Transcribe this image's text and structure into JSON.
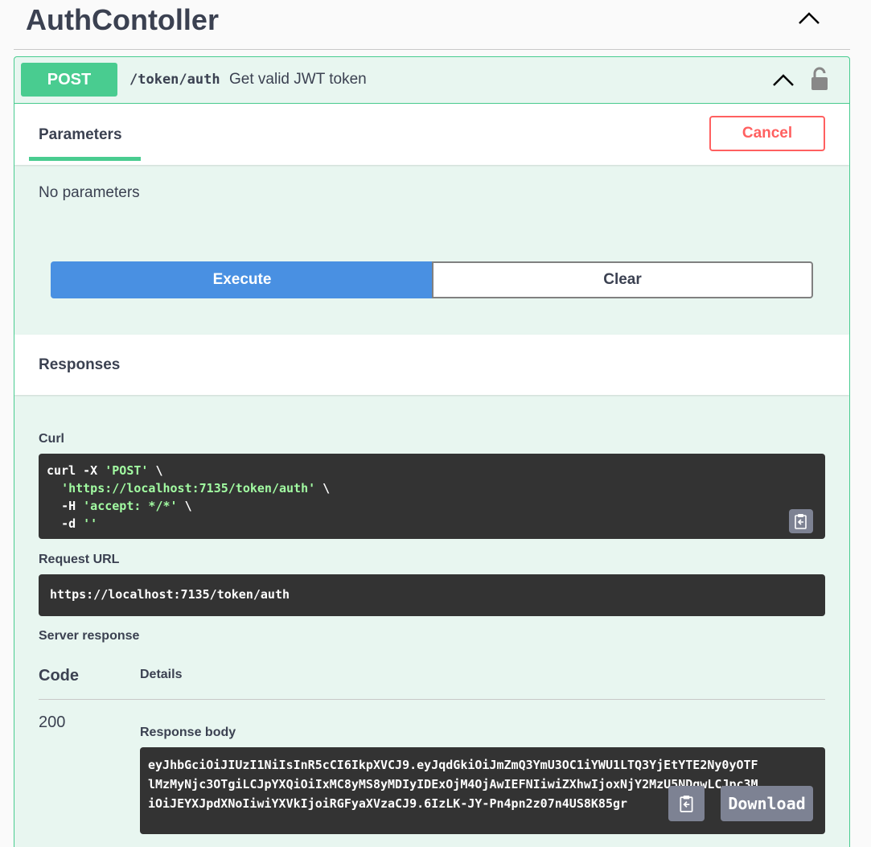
{
  "section": {
    "title": "AuthContoller",
    "collapse_icon": "chevron-up-icon"
  },
  "operation": {
    "method": "POST",
    "path": "/token/auth",
    "description": "Get valid JWT token",
    "collapse_icon": "chevron-up-icon",
    "lock_icon": "lock-icon"
  },
  "tabs": {
    "parameters": "Parameters",
    "cancel_label": "Cancel"
  },
  "parameters": {
    "empty_text": "No parameters"
  },
  "actions": {
    "execute_label": "Execute",
    "clear_label": "Clear"
  },
  "responses": {
    "title": "Responses",
    "curl_label": "Curl",
    "curl": {
      "line1_cmd": "curl -X ",
      "line1_str": "'POST'",
      "line1_end": " \\",
      "line2_str": "'https://localhost:7135/token/auth'",
      "line2_end": " \\",
      "line3_cmd": "-H ",
      "line3_str": "'accept: */*'",
      "line3_end": " \\",
      "line4_cmd": "-d ",
      "line4_str": "''"
    },
    "request_url_label": "Request URL",
    "request_url": "https://localhost:7135/token/auth",
    "server_response_label": "Server response",
    "code_header": "Code",
    "details_header": "Details",
    "code": "200",
    "response_body_label": "Response body",
    "response_body_lines": [
      "eyJhbGciOiJIUzI1NiIsInR5cCI6IkpXVCJ9.eyJqdGkiOiJmZmQ3YmU3OC1iYWU1LTQ3YjEtYTE2Ny0yOTF",
      "lMzMyNjc3OTgiLCJpYXQiOiIxMC8yMS8yMDIyIDExOjM4OjAwIEFNIiwiZXhwIjoxNjY2MzU5NDgwLCJpc3M",
      "iOiJEYXJpdXNoIiwiYXVkIjoiRGFyaXVzaCJ9.6IzLK-JY-Pn4pn2z07n4US8K85gr      9w"
    ],
    "download_label": "Download",
    "copy_icon": "clipboard-copy-icon"
  },
  "colors": {
    "post": "#49cc90",
    "execute": "#4990e2",
    "cancel": "#ff6060",
    "code_bg": "#333333"
  }
}
